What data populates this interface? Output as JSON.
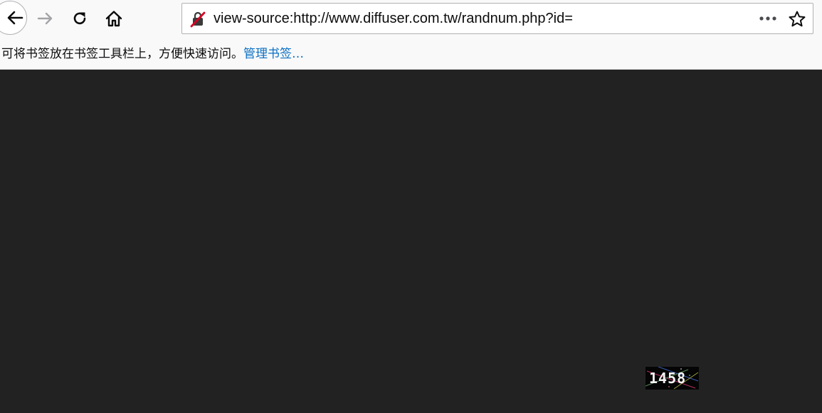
{
  "address_bar": {
    "url": "view-source:http://www.diffuser.com.tw/randnum.php?id="
  },
  "bookmarks_bar": {
    "hint_text": "可将书签放在书签工具栏上，方便快速访问。",
    "manage_link": "管理书签…"
  },
  "page": {
    "captcha_value": "1458"
  },
  "colors": {
    "chrome_background": "#f9f9fa",
    "content_background": "#222222",
    "link": "#0a6fc2",
    "insecure_icon": "#d70022"
  },
  "icons": {
    "back": "back-arrow-icon",
    "forward": "forward-arrow-icon",
    "reload": "reload-icon",
    "home": "home-icon",
    "insecure": "insecure-connection-icon",
    "page_actions": "more-actions-icon",
    "bookmark": "star-icon"
  }
}
